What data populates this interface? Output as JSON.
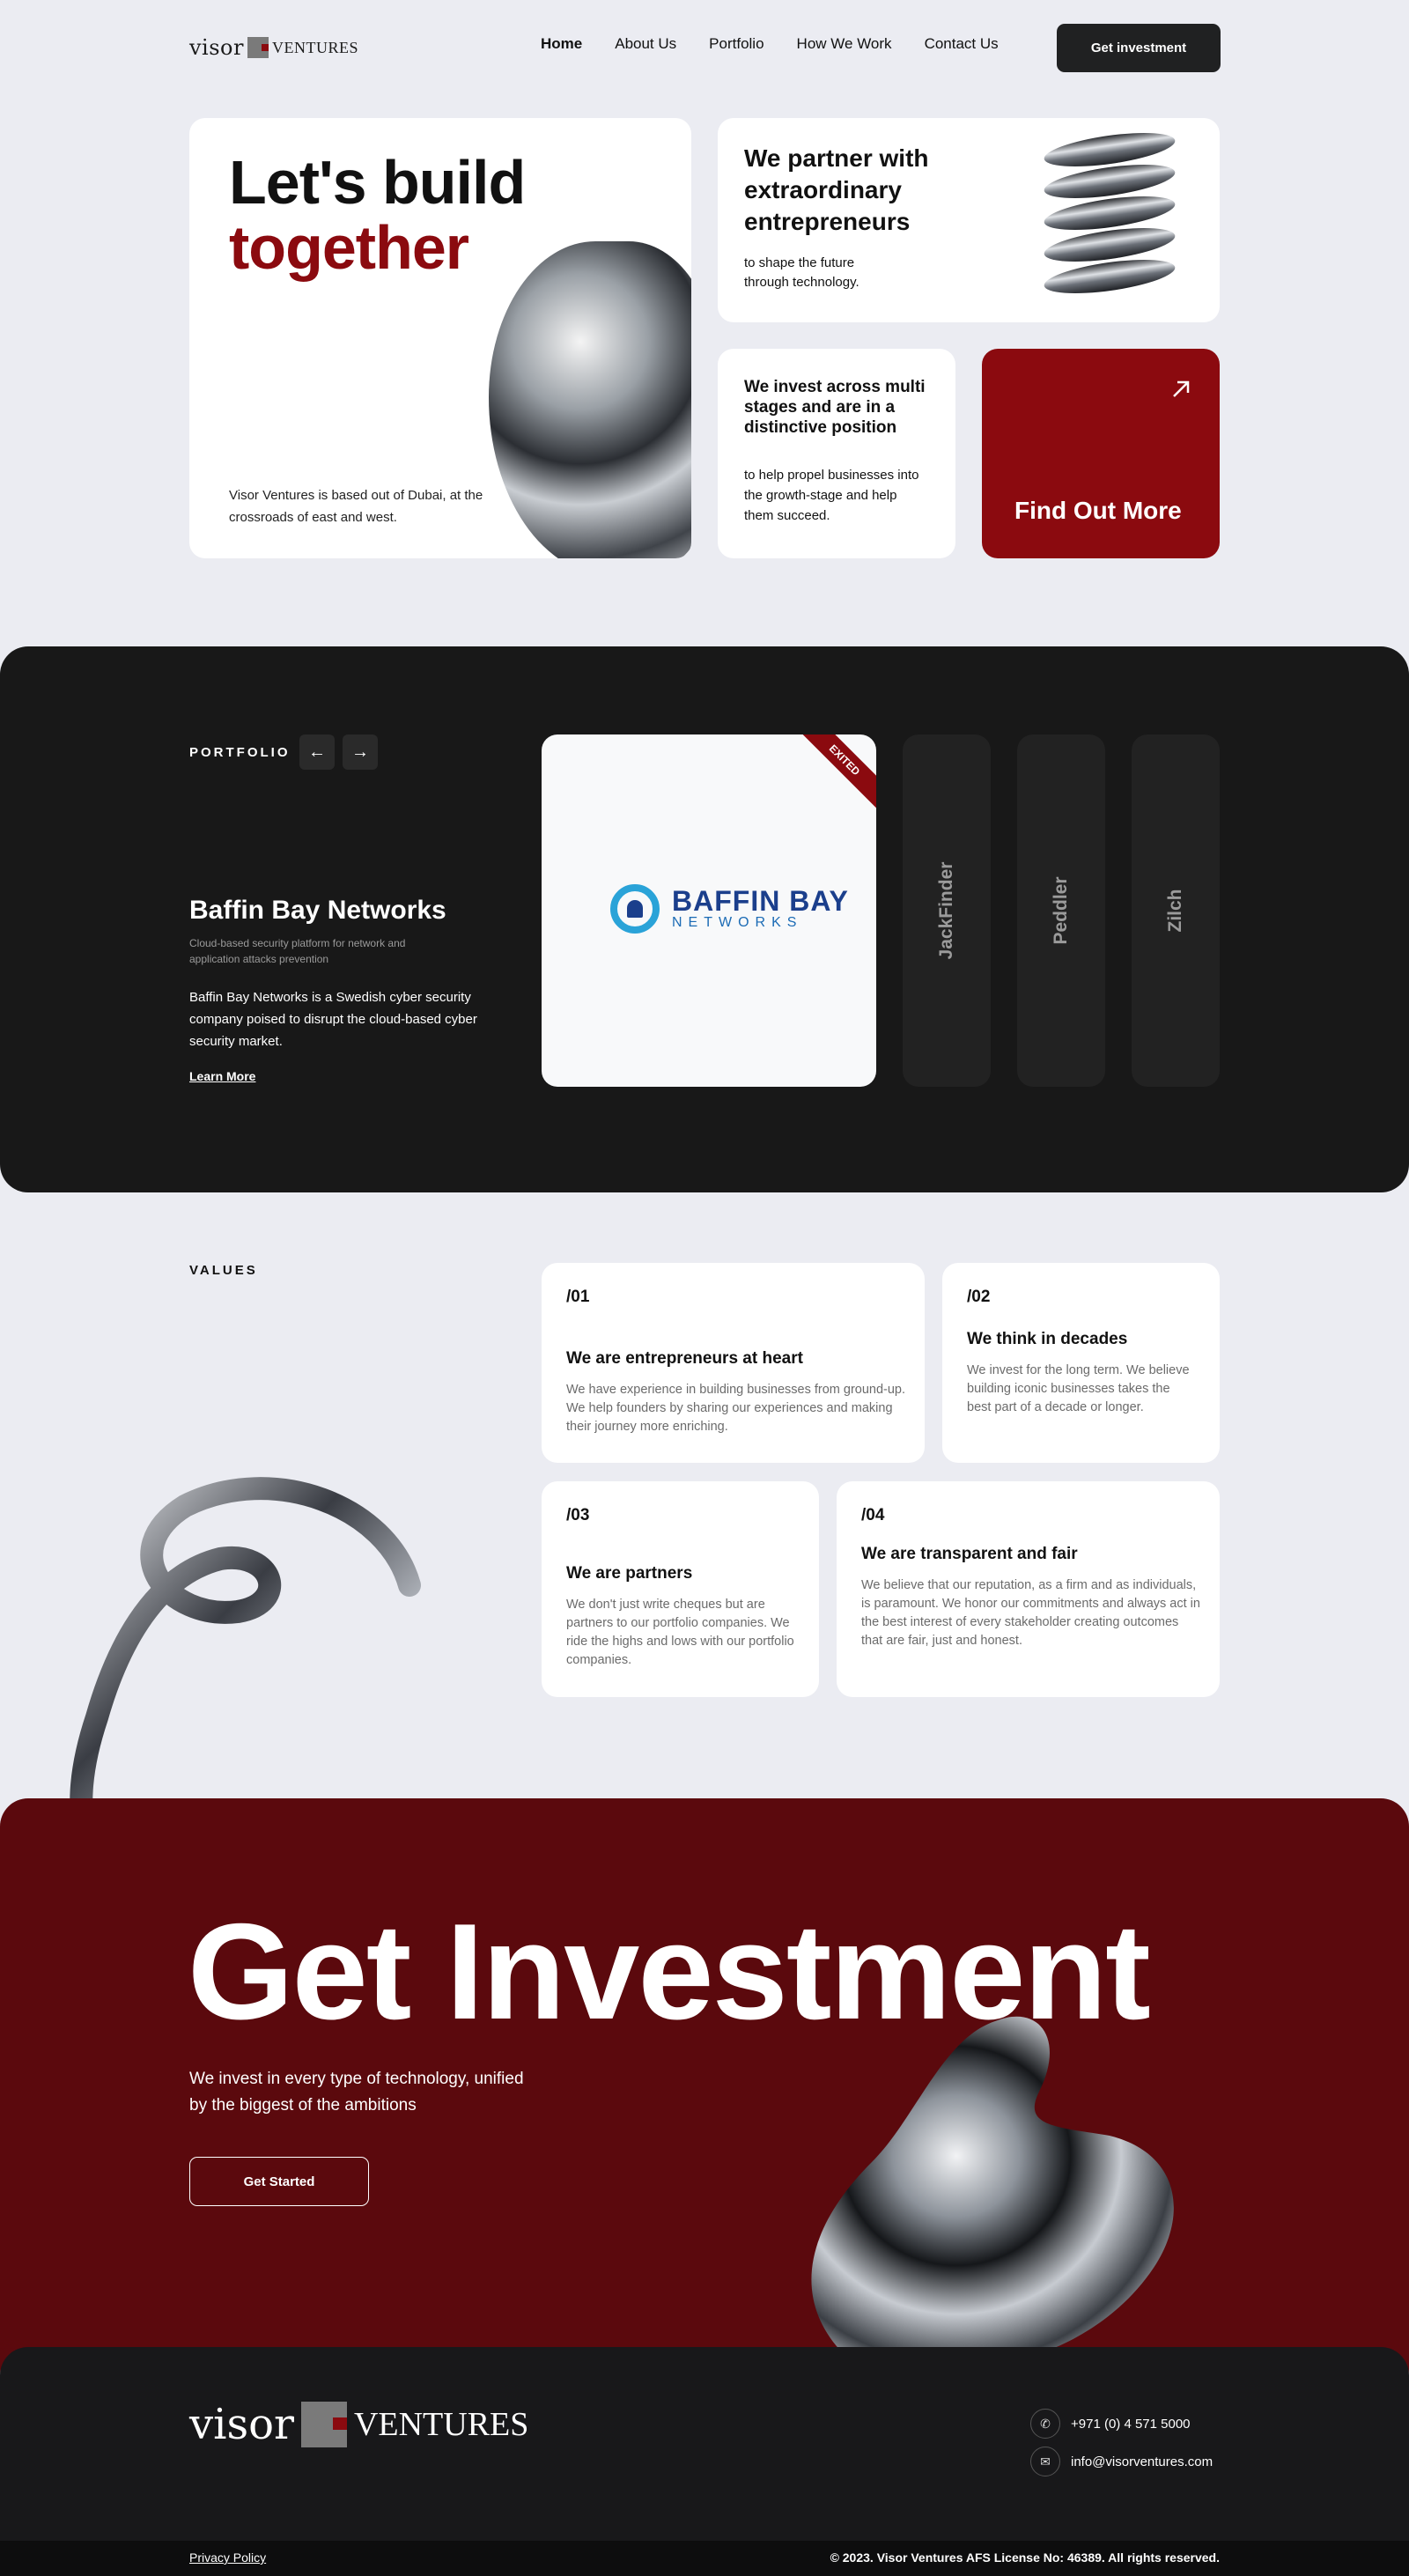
{
  "brand": {
    "logo_word1": "visor",
    "logo_word2": "VENTURES"
  },
  "nav": {
    "items": [
      "Home",
      "About Us",
      "Portfolio",
      "How We Work",
      "Contact Us"
    ],
    "active": "Home",
    "cta": "Get investment"
  },
  "hero": {
    "title_line1": "Let's build",
    "title_line2": "together",
    "subtitle": "Visor Ventures is based out of Dubai, at the crossroads of east and west.",
    "partner_heading": "We partner with extraordinary entrepreneurs",
    "partner_text": "to shape the future through technology.",
    "invest_heading": "We invest across multi stages and are in a distinctive position",
    "invest_text": "to help propel businesses into the growth-stage and help them succeed.",
    "findout_label": "Find Out More",
    "findout_icon": "arrow-up-right-icon"
  },
  "portfolio": {
    "label": "PORTFOLIO",
    "prev_icon": "arrow-left-icon",
    "next_icon": "arrow-right-icon",
    "prev_glyph": "←",
    "next_glyph": "→",
    "company": "Baffin Bay Networks",
    "tagline": "Cloud-based security platform for network and application attacks prevention",
    "description": "Baffin Bay Networks is a Swedish cyber security company poised to disrupt the cloud-based cyber security market.",
    "link": "Learn More",
    "ribbon": "EXITED",
    "logo_line1": "BAFFIN BAY",
    "logo_line2": "NETWORKS",
    "others": [
      "JackFinder",
      "Peddler",
      "Zilch"
    ]
  },
  "values": {
    "label": "VALUES",
    "items": [
      {
        "num": "/01",
        "title": "We are entrepreneurs at heart",
        "text": "We have experience in building businesses from ground-up. We help founders by sharing our experiences and making their journey more enriching."
      },
      {
        "num": "/02",
        "title": "We think in decades",
        "text": "We invest for the long term. We believe building iconic businesses takes the best part of a decade or longer."
      },
      {
        "num": "/03",
        "title": "We are partners",
        "text": "We don't just write cheques but are partners to our portfolio companies. We ride the highs and lows with our portfolio companies."
      },
      {
        "num": "/04",
        "title": "We are transparent and fair",
        "text": "We believe that our reputation, as a firm and as individuals, is paramount. We honor our commitments and always act in the best interest of every stakeholder creating outcomes that are fair, just and honest."
      }
    ]
  },
  "cta": {
    "title": "Get Investment",
    "subtitle": "We invest in every type of technology, unified by the biggest of the ambitions",
    "button": "Get Started"
  },
  "footer": {
    "phone": "+971 (0) 4 571 5000",
    "email": "info@visorventures.com",
    "phone_icon": "phone-icon",
    "email_icon": "mail-icon",
    "privacy": "Privacy Policy",
    "copyright": "© 2023. Visor Ventures AFS License No: 46389. All rights reserved."
  },
  "colors": {
    "accent": "#8b0a0f",
    "dark": "#181818",
    "cta_bg": "#5b090d",
    "page_bg": "#ebecf2"
  }
}
